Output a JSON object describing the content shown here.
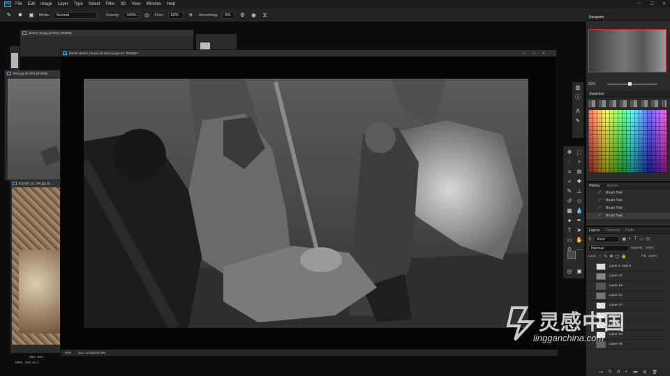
{
  "menu": {
    "logo": "Ps",
    "items": [
      "File",
      "Edit",
      "Image",
      "Layer",
      "Type",
      "Select",
      "Filter",
      "3D",
      "View",
      "Window",
      "Help"
    ],
    "window_controls": [
      "—",
      "☐",
      "✕"
    ]
  },
  "options": {
    "mode_label": "Mode:",
    "mode_value": "Normal",
    "opacity_label": "Opacity:",
    "opacity_value": "100%",
    "flow_label": "Flow:",
    "flow_value": "52%",
    "smoothing_label": "Smoothing:",
    "smoothing_value": "0%"
  },
  "documents": {
    "back1_title": "sketch_03.jpg @ 50% (RGB/8)",
    "back2_title": "files.jpg @ 50% (RGB/8)",
    "back3_title": "thumbn_01_HR.jpg @ ...",
    "main_title": "thumb sketch_03.psd @ 50% (Layer 67, RGB/8) *",
    "main_zoom": "50%",
    "main_doc_info": "Doc: 18.5M/246.6M",
    "back_zoom": "100%",
    "back_doc_info": "Doc: 61.4",
    "back_zoom2": "25%",
    "back_doc_info2": "Doc:"
  },
  "navigator": {
    "title": "Navigator",
    "zoom": "50%"
  },
  "swatches": {
    "title": "Swatches"
  },
  "history": {
    "tabs": [
      "History",
      "Actions"
    ],
    "items": [
      "Brush Tool",
      "Brush Tool",
      "Brush Tool",
      "Brush Tool"
    ]
  },
  "layers": {
    "tabs": [
      "Layers",
      "Channels",
      "Paths"
    ],
    "kind_label": "Kind",
    "blend_mode": "Normal",
    "opacity_label": "Opacity:",
    "opacity_value": "100%",
    "lock_label": "Lock:",
    "fill_label": "Fill:",
    "fill_value": "100%",
    "items": [
      "Layer 1 copy 8",
      "Layer 23",
      "Layer 16",
      "Layer 14",
      "Layer 27",
      "Layer 13",
      "Layer 19",
      "Layer 10",
      "Layer 25"
    ]
  },
  "watermark": {
    "brand_cn": "灵感中国",
    "brand_en": "lingganchina.com"
  },
  "colors": {
    "accent": "#31a8ff",
    "background": "#0c0c0c",
    "panel": "#2b2b2b"
  }
}
